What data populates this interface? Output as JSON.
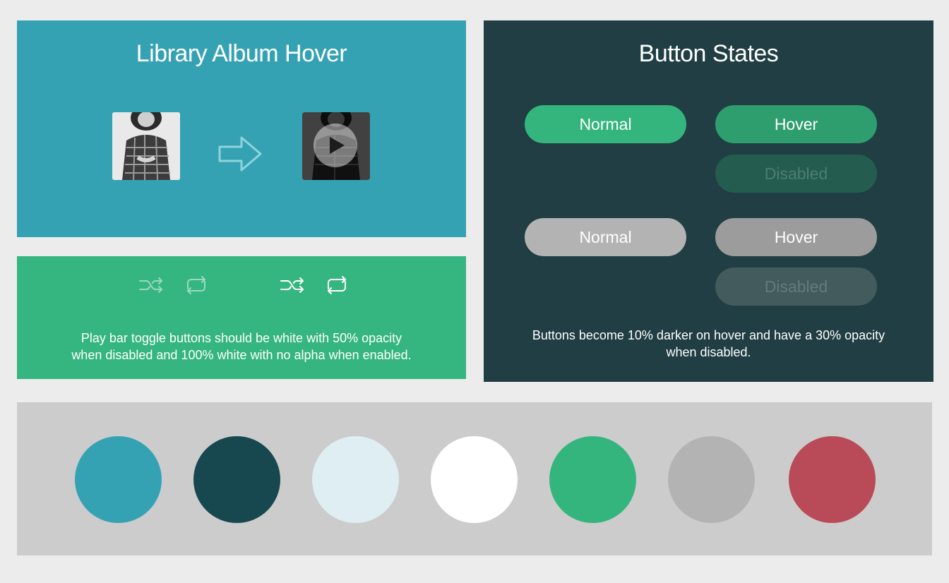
{
  "album_panel": {
    "title": "Library Album Hover"
  },
  "toggle_panel": {
    "icons": {
      "disabled": [
        "shuffle-icon",
        "repeat-icon"
      ],
      "enabled": [
        "shuffle-icon",
        "repeat-icon"
      ]
    },
    "note_line1": "Play bar toggle buttons should be white with 50% opacity",
    "note_line2": "when disabled and 100% white with no alpha when enabled."
  },
  "buttons_panel": {
    "title": "Button States",
    "green": {
      "normal": "Normal",
      "hover": "Hover",
      "disabled": "Disabled"
    },
    "gray": {
      "normal": "Normal",
      "hover": "Hover",
      "disabled": "Disabled"
    },
    "note_line1": "Buttons become 10% darker on hover and have a 30% opacity",
    "note_line2": "when disabled."
  },
  "palette": {
    "colors": [
      "#35a2b4",
      "#174850",
      "#deeef2",
      "#ffffff",
      "#34b57e",
      "#b3b3b3",
      "#b84b57"
    ]
  }
}
